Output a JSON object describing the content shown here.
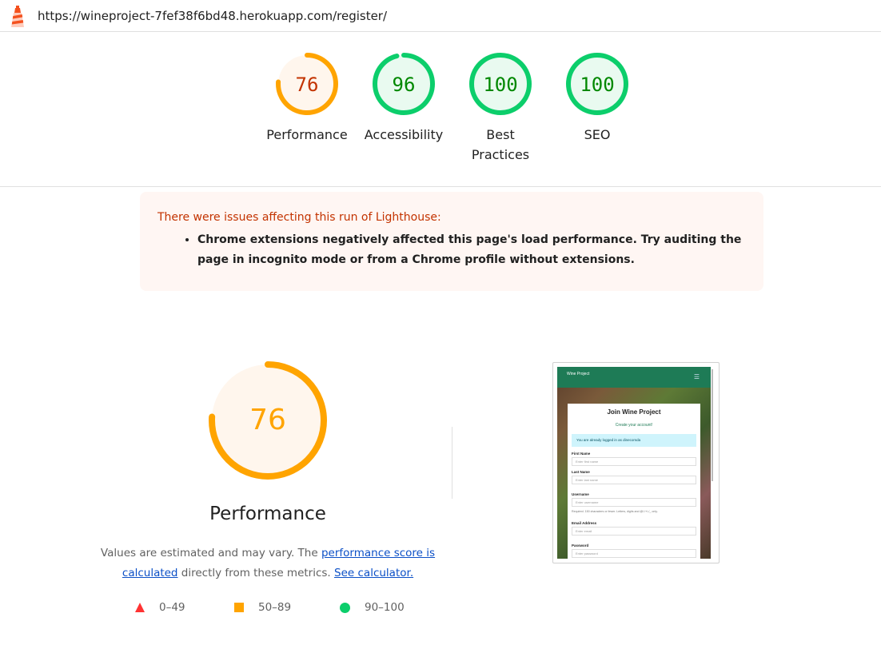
{
  "browser": {
    "url": "https://wineproject-7fef38f6bd48.herokuapp.com/register/"
  },
  "scores": [
    {
      "label": "Performance",
      "value": 76,
      "fraction": 0.76,
      "color": "#ffa400",
      "text_color": "#c33300",
      "bg": "#fff6ed"
    },
    {
      "label": "Accessibility",
      "value": 96,
      "fraction": 0.96,
      "color": "#0cce6b",
      "text_color": "#008800",
      "bg": "#e9faf0"
    },
    {
      "label": "Best Practices",
      "value": 100,
      "fraction": 1.0,
      "color": "#0cce6b",
      "text_color": "#008800",
      "bg": "#e9faf0"
    },
    {
      "label": "SEO",
      "value": 100,
      "fraction": 1.0,
      "color": "#0cce6b",
      "text_color": "#008800",
      "bg": "#e9faf0"
    }
  ],
  "warning": {
    "title": "There were issues affecting this run of Lighthouse:",
    "items": [
      "Chrome extensions negatively affected this page's load performance. Try auditing the page in incognito mode or from a Chrome profile without extensions."
    ]
  },
  "performance": {
    "score": 76,
    "fraction": 0.76,
    "title": "Performance",
    "desc_prefix": "Values are estimated and may vary. The ",
    "link_score": "performance score is calculated",
    "desc_middle": " directly from these metrics.",
    "link_calc": "See calculator."
  },
  "legend": [
    {
      "range": "0–49",
      "shape": "triangle-icon",
      "color": "#ff3333"
    },
    {
      "range": "50–89",
      "shape": "square-icon",
      "color": "#ffa400"
    },
    {
      "range": "90–100",
      "shape": "circle-icon",
      "color": "#0cce6b"
    }
  ],
  "thumbnail": {
    "brand": "Wine Project",
    "title": "Join Wine Project",
    "subtitle": "Create your account!",
    "alert": "You are already logged in as dinecomda",
    "fields": [
      {
        "label": "First Name",
        "placeholder": "Enter first name"
      },
      {
        "label": "Last Name",
        "placeholder": "Enter last name"
      },
      {
        "label": "Username",
        "placeholder": "Enter username"
      },
      {
        "label": "Email Address",
        "placeholder": "Enter email"
      },
      {
        "label": "Password",
        "placeholder": "Enter password"
      }
    ],
    "help": "Required. 150 characters or fewer. Letters, digits and @/./+/-/_ only."
  }
}
